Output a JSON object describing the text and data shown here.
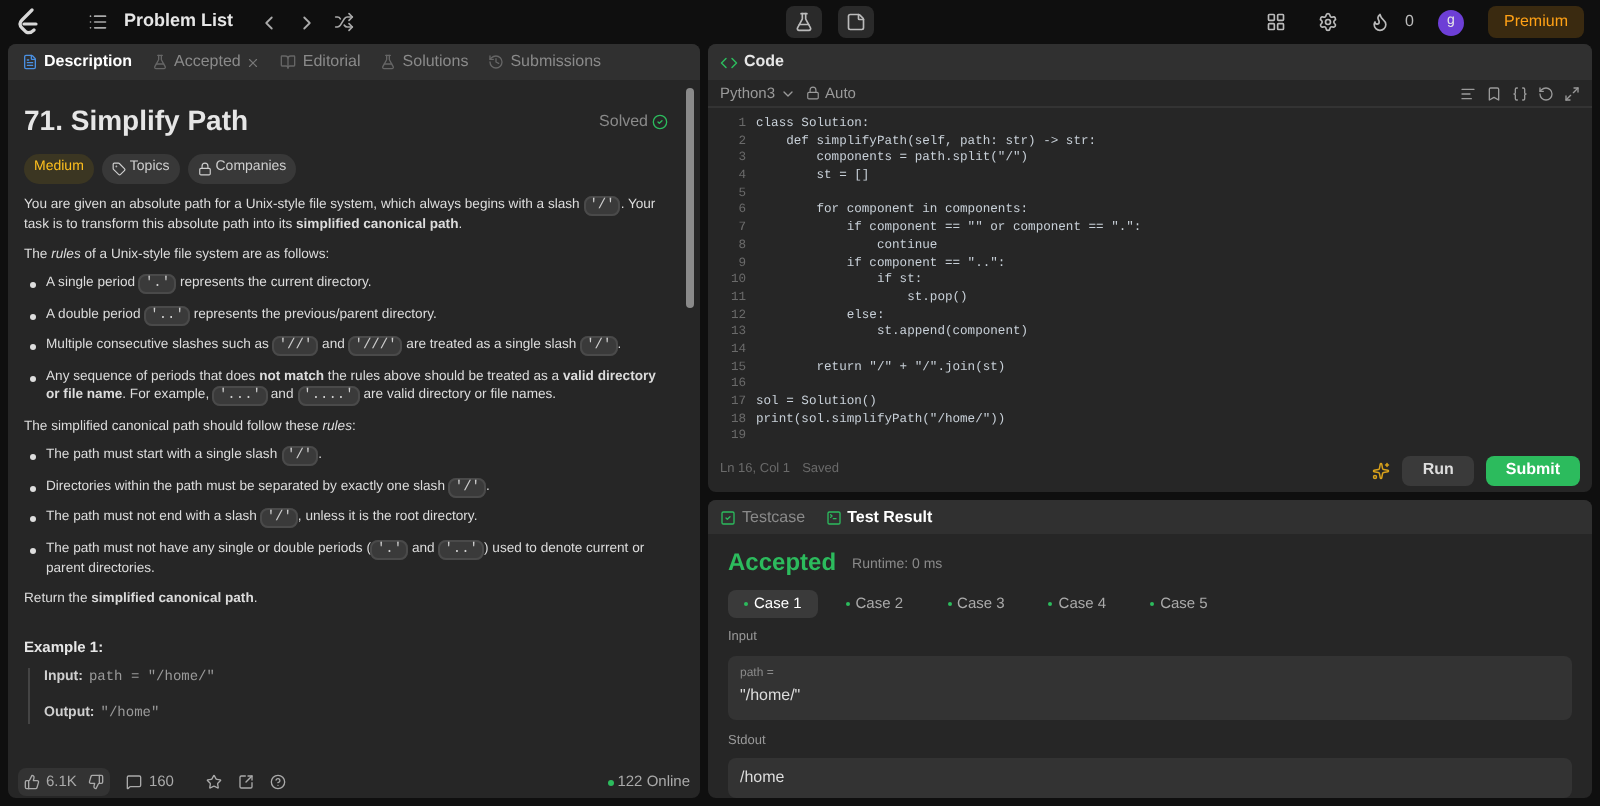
{
  "top_bar": {
    "title": "Problem List",
    "coins": "0",
    "avatar": "g",
    "premium": "Premium"
  },
  "left_tabs": [
    {
      "label": "Description",
      "selected": true,
      "closable": false
    },
    {
      "label": "Accepted",
      "selected": false,
      "closable": true
    },
    {
      "label": "Editorial",
      "selected": false,
      "closable": false
    },
    {
      "label": "Solutions",
      "selected": false,
      "closable": false
    },
    {
      "label": "Submissions",
      "selected": false,
      "closable": false
    }
  ],
  "problem": {
    "title": "71. Simplify Path",
    "status": "Solved",
    "difficulty": "Medium",
    "tags": [
      "Topics",
      "Companies"
    ]
  },
  "description": [
    {
      "kind": "paragraph",
      "segments": [
        {
          "kind": "text",
          "text": "You are given an absolute path for a Unix-style file system, which always begins with a slash "
        },
        {
          "kind": "code",
          "text": "'/'"
        },
        {
          "kind": "text",
          "text": ". Your task is to transform this absolute path into its **simplified canonical path**."
        }
      ]
    },
    {
      "kind": "paragraph",
      "segments": [
        {
          "kind": "text",
          "text": "The *rules* of a Unix-style file system are as follows:"
        }
      ]
    },
    {
      "kind": "bullet",
      "segments": [
        {
          "kind": "text",
          "text": "A single period "
        },
        {
          "kind": "code",
          "text": "'.'"
        },
        {
          "kind": "text",
          "text": " represents the current directory."
        }
      ]
    },
    {
      "kind": "bullet",
      "segments": [
        {
          "kind": "text",
          "text": "A double period "
        },
        {
          "kind": "code",
          "text": "'..'"
        },
        {
          "kind": "text",
          "text": " represents the previous/parent directory."
        }
      ]
    },
    {
      "kind": "bullet",
      "segments": [
        {
          "kind": "text",
          "text": "Multiple consecutive slashes such as "
        },
        {
          "kind": "code",
          "text": "'//'"
        },
        {
          "kind": "text",
          "text": " and "
        },
        {
          "kind": "code",
          "text": "'///'"
        },
        {
          "kind": "text",
          "text": " are treated as a single slash "
        },
        {
          "kind": "code",
          "text": "'/'"
        },
        {
          "kind": "text",
          "text": "."
        }
      ]
    },
    {
      "kind": "bullet",
      "segments": [
        {
          "kind": "text",
          "text": "Any sequence of periods that does **not match** the rules above should be treated as a **valid directory or file name**. For example, "
        },
        {
          "kind": "code",
          "text": "'...'"
        },
        {
          "kind": "text",
          "text": " and "
        },
        {
          "kind": "code",
          "text": "'....'"
        },
        {
          "kind": "text",
          "text": " are valid directory or file names."
        }
      ]
    },
    {
      "kind": "paragraph",
      "segments": [
        {
          "kind": "text",
          "text": "The simplified canonical path should follow these *rules*:"
        }
      ]
    },
    {
      "kind": "bullet",
      "segments": [
        {
          "kind": "text",
          "text": "The path must start with a single slash "
        },
        {
          "kind": "code",
          "text": "'/'"
        },
        {
          "kind": "text",
          "text": "."
        }
      ]
    },
    {
      "kind": "bullet",
      "segments": [
        {
          "kind": "text",
          "text": "Directories within the path must be separated by exactly one slash "
        },
        {
          "kind": "code",
          "text": "'/'"
        },
        {
          "kind": "text",
          "text": "."
        }
      ]
    },
    {
      "kind": "bullet",
      "segments": [
        {
          "kind": "text",
          "text": "The path must not end with a slash "
        },
        {
          "kind": "code",
          "text": "'/'"
        },
        {
          "kind": "text",
          "text": ", unless it is the root directory."
        }
      ]
    },
    {
      "kind": "bullet",
      "segments": [
        {
          "kind": "text",
          "text": "The path must not have any single or double periods ("
        },
        {
          "kind": "code",
          "text": "'.'"
        },
        {
          "kind": "text",
          "text": " and "
        },
        {
          "kind": "code",
          "text": "'..'"
        },
        {
          "kind": "text",
          "text": ") used to denote current or parent directories."
        }
      ]
    },
    {
      "kind": "paragraph",
      "segments": [
        {
          "kind": "text",
          "text": "Return the **simplified canonical path**."
        }
      ]
    }
  ],
  "example": {
    "heading": "Example 1:",
    "lines": [
      {
        "label": "Input:",
        "value": "path = \"/home/\""
      },
      {
        "label": "Output:",
        "value": "\"/home\""
      }
    ]
  },
  "footer": {
    "likes": "6.1K",
    "comments": "160",
    "online": "122 Online"
  },
  "code_panel": {
    "title": "Code",
    "language": "Python3",
    "mode": "Auto",
    "lines": [
      {
        "number": "1",
        "text": "class Solution:"
      },
      {
        "number": "2",
        "text": "    def simplifyPath(self, path: str) -> str:"
      },
      {
        "number": "3",
        "text": "        components = path.split(\"/\")"
      },
      {
        "number": "4",
        "text": "        st = []"
      },
      {
        "number": "5"
      },
      {
        "number": "6",
        "text": "        for component in components:"
      },
      {
        "number": "7",
        "text": "            if component == \"\" or component == \".\":"
      },
      {
        "number": "8",
        "text": "                continue"
      },
      {
        "number": "9",
        "text": "            if component == \"..\":"
      },
      {
        "number": "10",
        "text": "                if st:"
      },
      {
        "number": "11",
        "text": "                    st.pop()"
      },
      {
        "number": "12",
        "text": "            else:"
      },
      {
        "number": "13",
        "text": "                st.append(component)"
      },
      {
        "number": "14"
      },
      {
        "number": "15",
        "text": "        return \"/\" + \"/\".join(st)"
      },
      {
        "number": "16"
      },
      {
        "number": "17",
        "text": "sol = Solution()"
      },
      {
        "number": "18",
        "text": "print(sol.simplifyPath(\"/home/\"))"
      },
      {
        "number": "19"
      }
    ],
    "position": "Ln 16, Col 1",
    "saved": "Saved",
    "run": "Run",
    "submit": "Submit"
  },
  "test_panel": {
    "tabs": [
      {
        "label": "Testcase",
        "selected": false
      },
      {
        "label": "Test Result",
        "selected": true
      }
    ],
    "verdict": "Accepted",
    "runtime": "Runtime: 0 ms",
    "cases": [
      {
        "label": "Case 1",
        "selected": true
      },
      {
        "label": "Case 2",
        "selected": false
      },
      {
        "label": "Case 3",
        "selected": false
      },
      {
        "label": "Case 4",
        "selected": false
      },
      {
        "label": "Case 5",
        "selected": false
      }
    ],
    "input_label": "Input",
    "param": "path =",
    "input_value": "\"/home/\"",
    "stdout_label": "Stdout",
    "stdout": "/home"
  }
}
